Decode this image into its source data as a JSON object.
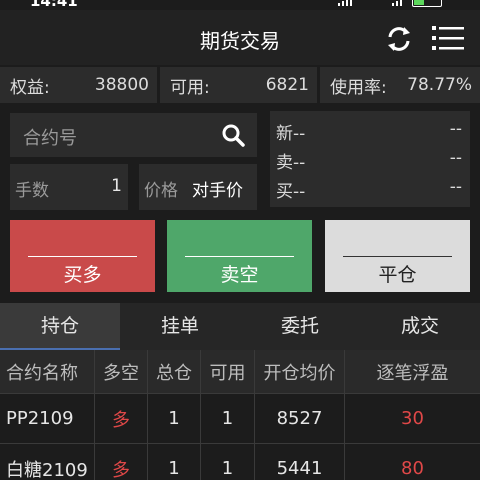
{
  "status_bar": {
    "time": "14:41"
  },
  "header": {
    "title": "期货交易",
    "icons": [
      "refresh-icon",
      "menu-icon"
    ]
  },
  "account": {
    "equity_label": "权益:",
    "equity_value": "38800",
    "available_label": "可用:",
    "available_value": "6821",
    "usage_label": "使用率:",
    "usage_value": "78.77%"
  },
  "order_form": {
    "contract_placeholder": "合约号",
    "qty_label": "手数",
    "qty_value": "1",
    "price_label": "价格",
    "price_value": "对手价"
  },
  "quote": {
    "rows": [
      {
        "label": "新--",
        "value": "--"
      },
      {
        "label": "卖--",
        "value": "--"
      },
      {
        "label": "买--",
        "value": "--"
      }
    ]
  },
  "actions": {
    "buy_long": "买多",
    "sell_short": "卖空",
    "close": "平仓"
  },
  "tabs": [
    "持仓",
    "挂单",
    "委托",
    "成交"
  ],
  "positions": {
    "columns": [
      "合约名称",
      "多空",
      "总仓",
      "可用",
      "开仓均价",
      "逐笔浮盈"
    ],
    "rows": [
      {
        "name": "PP2109",
        "direction": "多",
        "total": "1",
        "available": "1",
        "avg_price": "8527",
        "pnl": "30"
      },
      {
        "name": "白糖2109",
        "direction": "多",
        "total": "1",
        "available": "1",
        "avg_price": "5441",
        "pnl": "80"
      }
    ]
  },
  "colors": {
    "buy": "#c94a4a",
    "sell": "#4fa76a",
    "close": "#dcdcdc",
    "profit": "#e04848",
    "tab_active_underline": "#4a6fb0"
  }
}
